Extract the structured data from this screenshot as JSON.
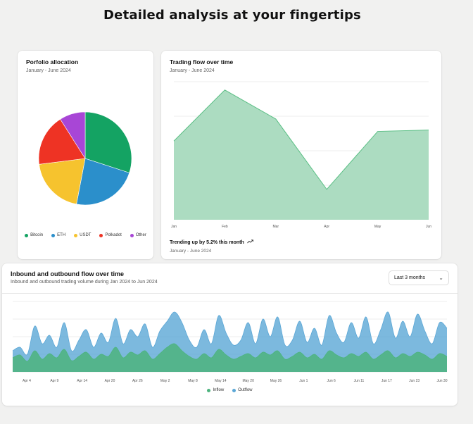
{
  "page": {
    "title": "Detailed analysis at your fingertips"
  },
  "pie_card": {
    "title": "Porfolio allocation",
    "subtitle": "January - June 2024"
  },
  "area_card": {
    "title": "Trading flow over time",
    "subtitle": "January - June 2024",
    "trend_text": "Trending up by 5.2% this month",
    "trend_sub": "January - June 2024"
  },
  "flow_card": {
    "title": "Inbound and outbound flow over time",
    "subtitle": "Inbound and outbound trading volume during Jan 2024 to Jun 2024",
    "range_select": "Last 3 months"
  },
  "colors": {
    "pie": [
      "#14a363",
      "#2b8fcb",
      "#f6c32e",
      "#ee3324",
      "#a846d6"
    ],
    "area_fill": "#acdcc1",
    "area_line": "#5bbf85",
    "inflow": "#4db37e",
    "outflow": "#5ba7d6"
  },
  "icons": {
    "trend": "trending-up-icon",
    "select": "chevron-down-icon"
  },
  "chart_data": [
    {
      "type": "pie",
      "categories": [
        "Bitcoin",
        "ETH",
        "USDT",
        "Polkadot",
        "Other"
      ],
      "values": [
        30,
        23,
        20,
        18,
        9
      ],
      "legend": "bottom"
    },
    {
      "type": "area",
      "categories": [
        "Jan",
        "Feb",
        "Mar",
        "Apr",
        "May",
        "Jun"
      ],
      "values": [
        57,
        94,
        73,
        22,
        64,
        65
      ],
      "ylim": [
        0,
        100
      ],
      "grid": true
    },
    {
      "type": "area",
      "categories": [
        "Apr 4",
        "Apr 9",
        "Apr 14",
        "Apr 20",
        "Apr 26",
        "May 2",
        "May 8",
        "May 14",
        "May 20",
        "May 26",
        "Jun 1",
        "Jun 6",
        "Jun 11",
        "Jun 17",
        "Jun 23",
        "Jun 30"
      ],
      "ylim": [
        0,
        100
      ],
      "grid": true,
      "legend": "bottom",
      "series": [
        {
          "name": "Inflow",
          "values": [
            20,
            24,
            15,
            30,
            18,
            26,
            20,
            32,
            16,
            22,
            28,
            18,
            25,
            22,
            35,
            20,
            28,
            24,
            30,
            18,
            26,
            35,
            40,
            30,
            22,
            18,
            26,
            20,
            32,
            24,
            18,
            22,
            26,
            20,
            28,
            24,
            30,
            18,
            22,
            28,
            20,
            25,
            18,
            30,
            24,
            20,
            26,
            22,
            28,
            18,
            24,
            30,
            20,
            26,
            22,
            28,
            24,
            18,
            26,
            22
          ]
        },
        {
          "name": "Outflow",
          "values": [
            30,
            35,
            25,
            65,
            40,
            52,
            35,
            70,
            30,
            45,
            60,
            35,
            55,
            42,
            76,
            40,
            60,
            50,
            68,
            35,
            58,
            72,
            85,
            70,
            45,
            35,
            60,
            40,
            80,
            55,
            38,
            45,
            70,
            40,
            75,
            50,
            78,
            38,
            45,
            72,
            42,
            62,
            38,
            80,
            55,
            42,
            70,
            48,
            78,
            40,
            60,
            85,
            48,
            72,
            50,
            82,
            58,
            40,
            70,
            62
          ]
        }
      ]
    }
  ]
}
